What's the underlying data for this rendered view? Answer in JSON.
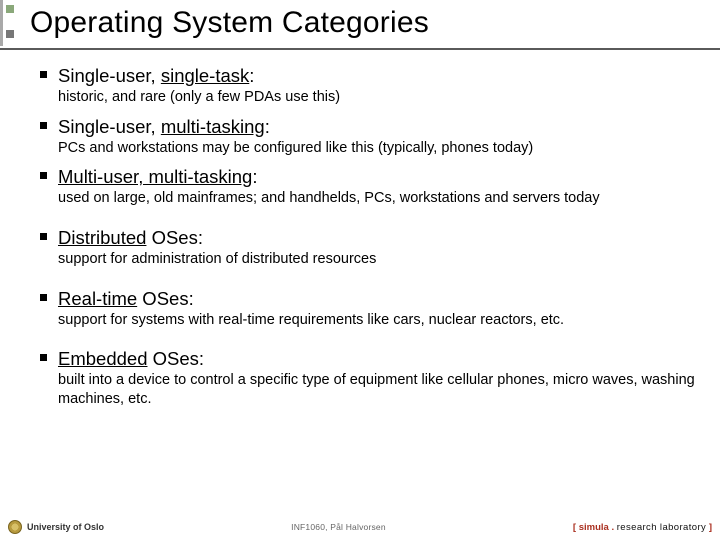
{
  "title": "Operating System Categories",
  "items": [
    {
      "heading_pre": "Single-user, ",
      "heading_u": "single-task",
      "heading_post": ":",
      "sub": "historic, and rare (only a few PDAs use this)",
      "spaced": false
    },
    {
      "heading_pre": "Single-user, ",
      "heading_u": "multi-tasking",
      "heading_post": ":",
      "sub": "PCs and workstations may be configured like this (typically, phones today)",
      "spaced": false
    },
    {
      "heading_pre": "",
      "heading_u": "Multi-user, multi-tasking",
      "heading_post": ":",
      "sub": "used on large, old mainframes; and handhelds, PCs, workstations and servers today",
      "spaced": false
    },
    {
      "heading_pre": "",
      "heading_u": "Distributed",
      "heading_post": " OSes:",
      "sub": "support for administration of distributed resources",
      "spaced": true
    },
    {
      "heading_pre": "",
      "heading_u": "Real-time",
      "heading_post": " OSes:",
      "sub": "support for systems with real-time requirements like cars, nuclear reactors, etc.",
      "spaced": true
    },
    {
      "heading_pre": "",
      "heading_u": "Embedded",
      "heading_post": " OSes:",
      "sub": "built into a device to control a specific type of equipment like cellular phones, micro waves, washing machines, etc.",
      "spaced": true
    }
  ],
  "footer": {
    "left": "University of Oslo",
    "mid": "INF1060, Pål Halvorsen",
    "right_open": "[ ",
    "right_brand": "simula",
    "right_dot": " . ",
    "right_lab": "research laboratory",
    "right_close": " ]"
  }
}
